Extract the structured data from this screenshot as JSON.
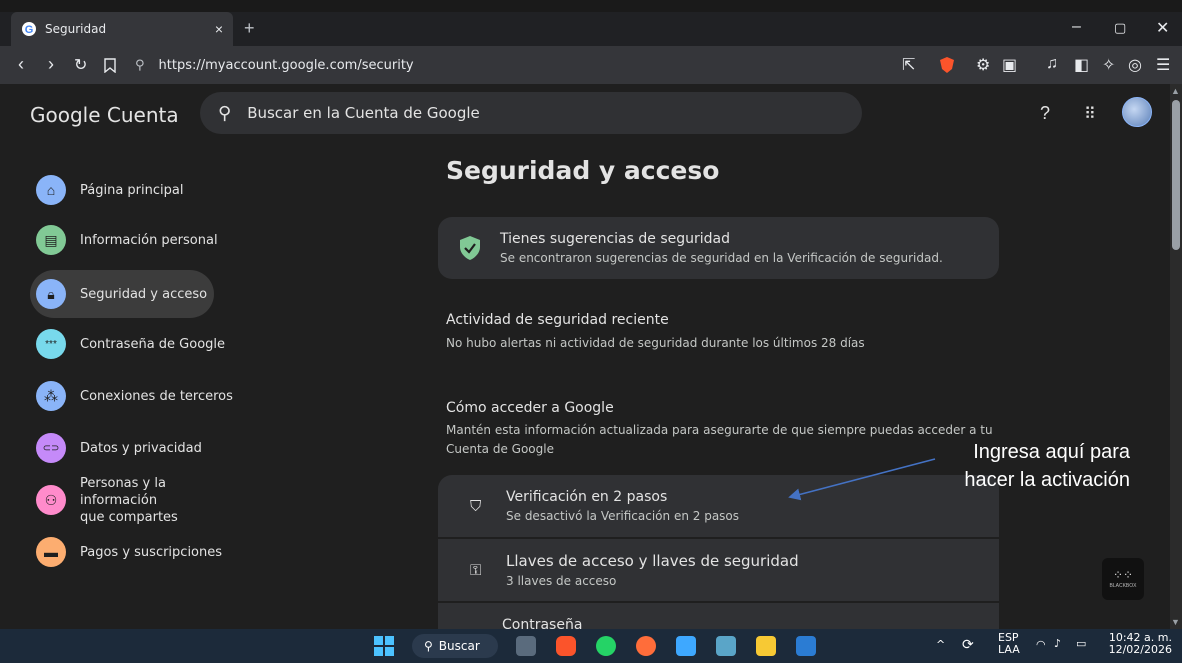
{
  "browser": {
    "tab_title": "Seguridad",
    "tab_close": "×",
    "new_tab": "+",
    "url": "https://myaccount.google.com/security",
    "window_controls": [
      "minimize-icon",
      "restore-icon",
      "close-icon"
    ]
  },
  "header": {
    "logo": "Google Cuenta",
    "search_placeholder": "Buscar en la Cuenta de Google"
  },
  "sidebar": {
    "items": [
      {
        "label": "Página principal",
        "icon": "home-icon",
        "color": "#8ab4f8"
      },
      {
        "label": "Información personal",
        "icon": "id-card-icon",
        "color": "#81c995"
      },
      {
        "label": "Seguridad y acceso",
        "icon": "lock-icon",
        "color": "#8ab4f8",
        "active": true
      },
      {
        "label": "Contraseña de Google",
        "icon": "password-dots-icon",
        "color": "#78d9ec"
      },
      {
        "label": "Conexiones de terceros",
        "icon": "connections-icon",
        "color": "#8ab4f8"
      },
      {
        "label": "Datos y privacidad",
        "icon": "toggle-icon",
        "color": "#c58af9"
      },
      {
        "label": "Personas y la información que compartes",
        "icon": "people-icon",
        "color": "#ff8bcb"
      },
      {
        "label": "Pagos y suscripciones",
        "icon": "wallet-icon",
        "color": "#fcad70"
      }
    ]
  },
  "main": {
    "title": "Seguridad y acceso",
    "suggestion": {
      "title": "Tienes sugerencias de seguridad",
      "subtitle": "Se encontraron sugerencias de seguridad en la Verificación de seguridad."
    },
    "recent": {
      "title": "Actividad de seguridad reciente",
      "text": "No hubo alertas ni actividad de seguridad durante los últimos 28 días"
    },
    "access": {
      "title": "Cómo acceder a Google",
      "text_line1": "Mantén esta información actualizada para asegurarte de que siempre puedas acceder a tu",
      "text_line2": "Cuenta de Google"
    },
    "rows": [
      {
        "title": "Verificación en 2 pasos",
        "subtitle": "Se desactivó la Verificación en 2 pasos"
      },
      {
        "title": "Llaves de acceso y llaves de seguridad",
        "subtitle": "3 llaves de acceso"
      },
      {
        "title": "Contraseña",
        "subtitle": ""
      }
    ]
  },
  "annotation": {
    "line1": "Ingresa aquí para",
    "line2": "hacer la activación",
    "color": "#4472c4"
  },
  "watermark": "BLACKBOX",
  "taskbar": {
    "search_label": "Buscar",
    "lang1": "ESP",
    "lang2": "LAA",
    "time": "10:42 a. m.",
    "date": "12/02/2026"
  }
}
